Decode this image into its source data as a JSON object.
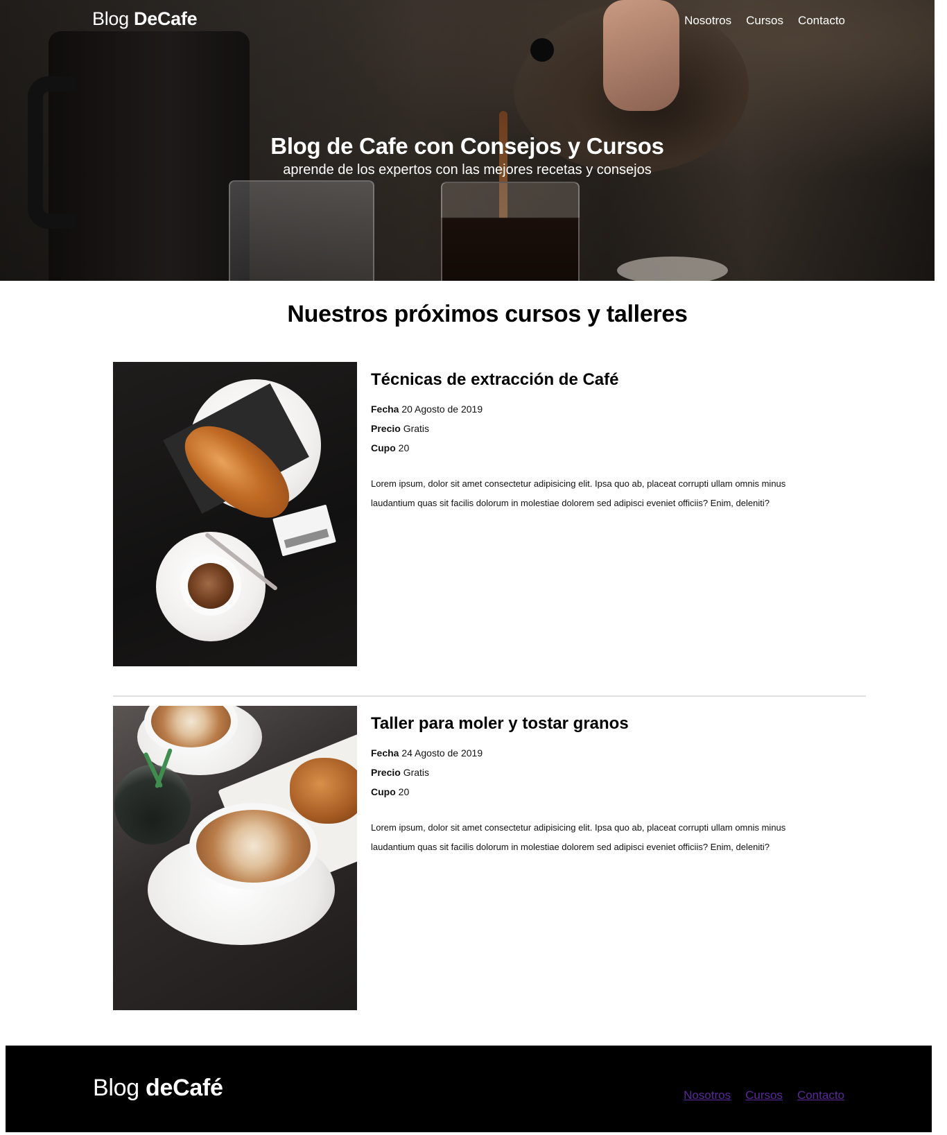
{
  "header": {
    "logo_light": "Blog ",
    "logo_bold": "DeCafe",
    "nav": [
      {
        "label": "Nosotros"
      },
      {
        "label": "Cursos"
      },
      {
        "label": "Contacto"
      }
    ],
    "hero_title": "Blog de Cafe con Consejos y Cursos",
    "hero_subtitle": "aprende de los expertos con las mejores recetas y consejos"
  },
  "main": {
    "section_title": "Nuestros próximos cursos y talleres",
    "courses": [
      {
        "title": "Técnicas de extracción de Café",
        "fecha_label": "Fecha",
        "fecha": "20 Agosto de 2019",
        "precio_label": "Precio",
        "precio": "Gratis",
        "cupo_label": "Cupo",
        "cupo": "20",
        "description": "Lorem ipsum, dolor sit amet consectetur adipisicing elit. Ipsa quo ab, placeat corrupti ullam omnis minus laudantium quas sit facilis dolorum in molestiae dolorem sed adipisci eveniet officiis? Enim, deleniti?"
      },
      {
        "title": "Taller para moler y tostar granos",
        "fecha_label": "Fecha",
        "fecha": "24 Agosto de 2019",
        "precio_label": "Precio",
        "precio": "Gratis",
        "cupo_label": "Cupo",
        "cupo": "20",
        "description": "Lorem ipsum, dolor sit amet consectetur adipisicing elit. Ipsa quo ab, placeat corrupti ullam omnis minus laudantium quas sit facilis dolorum in molestiae dolorem sed adipisci eveniet officiis? Enim, deleniti?"
      }
    ]
  },
  "footer": {
    "logo_light": "Blog ",
    "logo_bold": "deCafé",
    "nav": [
      {
        "label": "Nosotros"
      },
      {
        "label": "Cursos"
      },
      {
        "label": "Contacto"
      }
    ],
    "link_color": "#3a1fd0"
  }
}
